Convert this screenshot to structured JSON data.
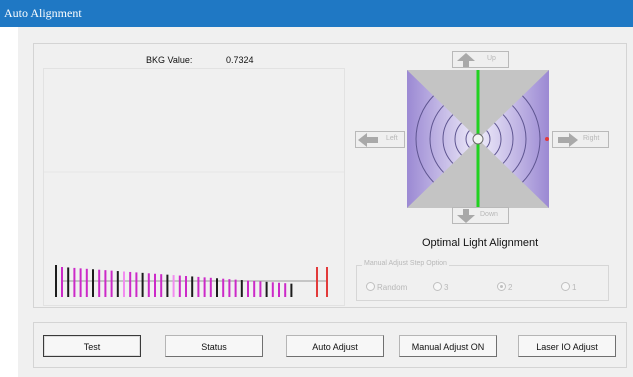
{
  "window": {
    "title": "Auto Alignment"
  },
  "bkg": {
    "label": "BKG Value:",
    "value": "0.7324"
  },
  "alignment": {
    "up": "Up",
    "down": "Down",
    "left": "Left",
    "right": "Right",
    "caption": "Optimal Light Alignment"
  },
  "manual_step": {
    "legend": "Manual Adjust Step Option",
    "options": [
      "Random",
      "3",
      "2",
      "1"
    ],
    "selected": "2"
  },
  "buttons": {
    "test": "Test",
    "status": "Status",
    "auto_adjust": "Auto Adjust",
    "manual_adjust": "Manual Adjust ON",
    "laser_io": "Laser IO Adjust"
  },
  "colors": {
    "title_bar": "#1f78c4",
    "bar_magenta": "#cc29c8",
    "bar_dark": "#1c1c1c",
    "bar_red": "#e23a3a",
    "crosshair_green": "#21d221",
    "target_purple": "#9f8ed6"
  },
  "icons": {
    "up": "arrow-up-icon",
    "down": "arrow-down-icon",
    "left": "arrow-left-icon",
    "right": "arrow-right-icon"
  }
}
